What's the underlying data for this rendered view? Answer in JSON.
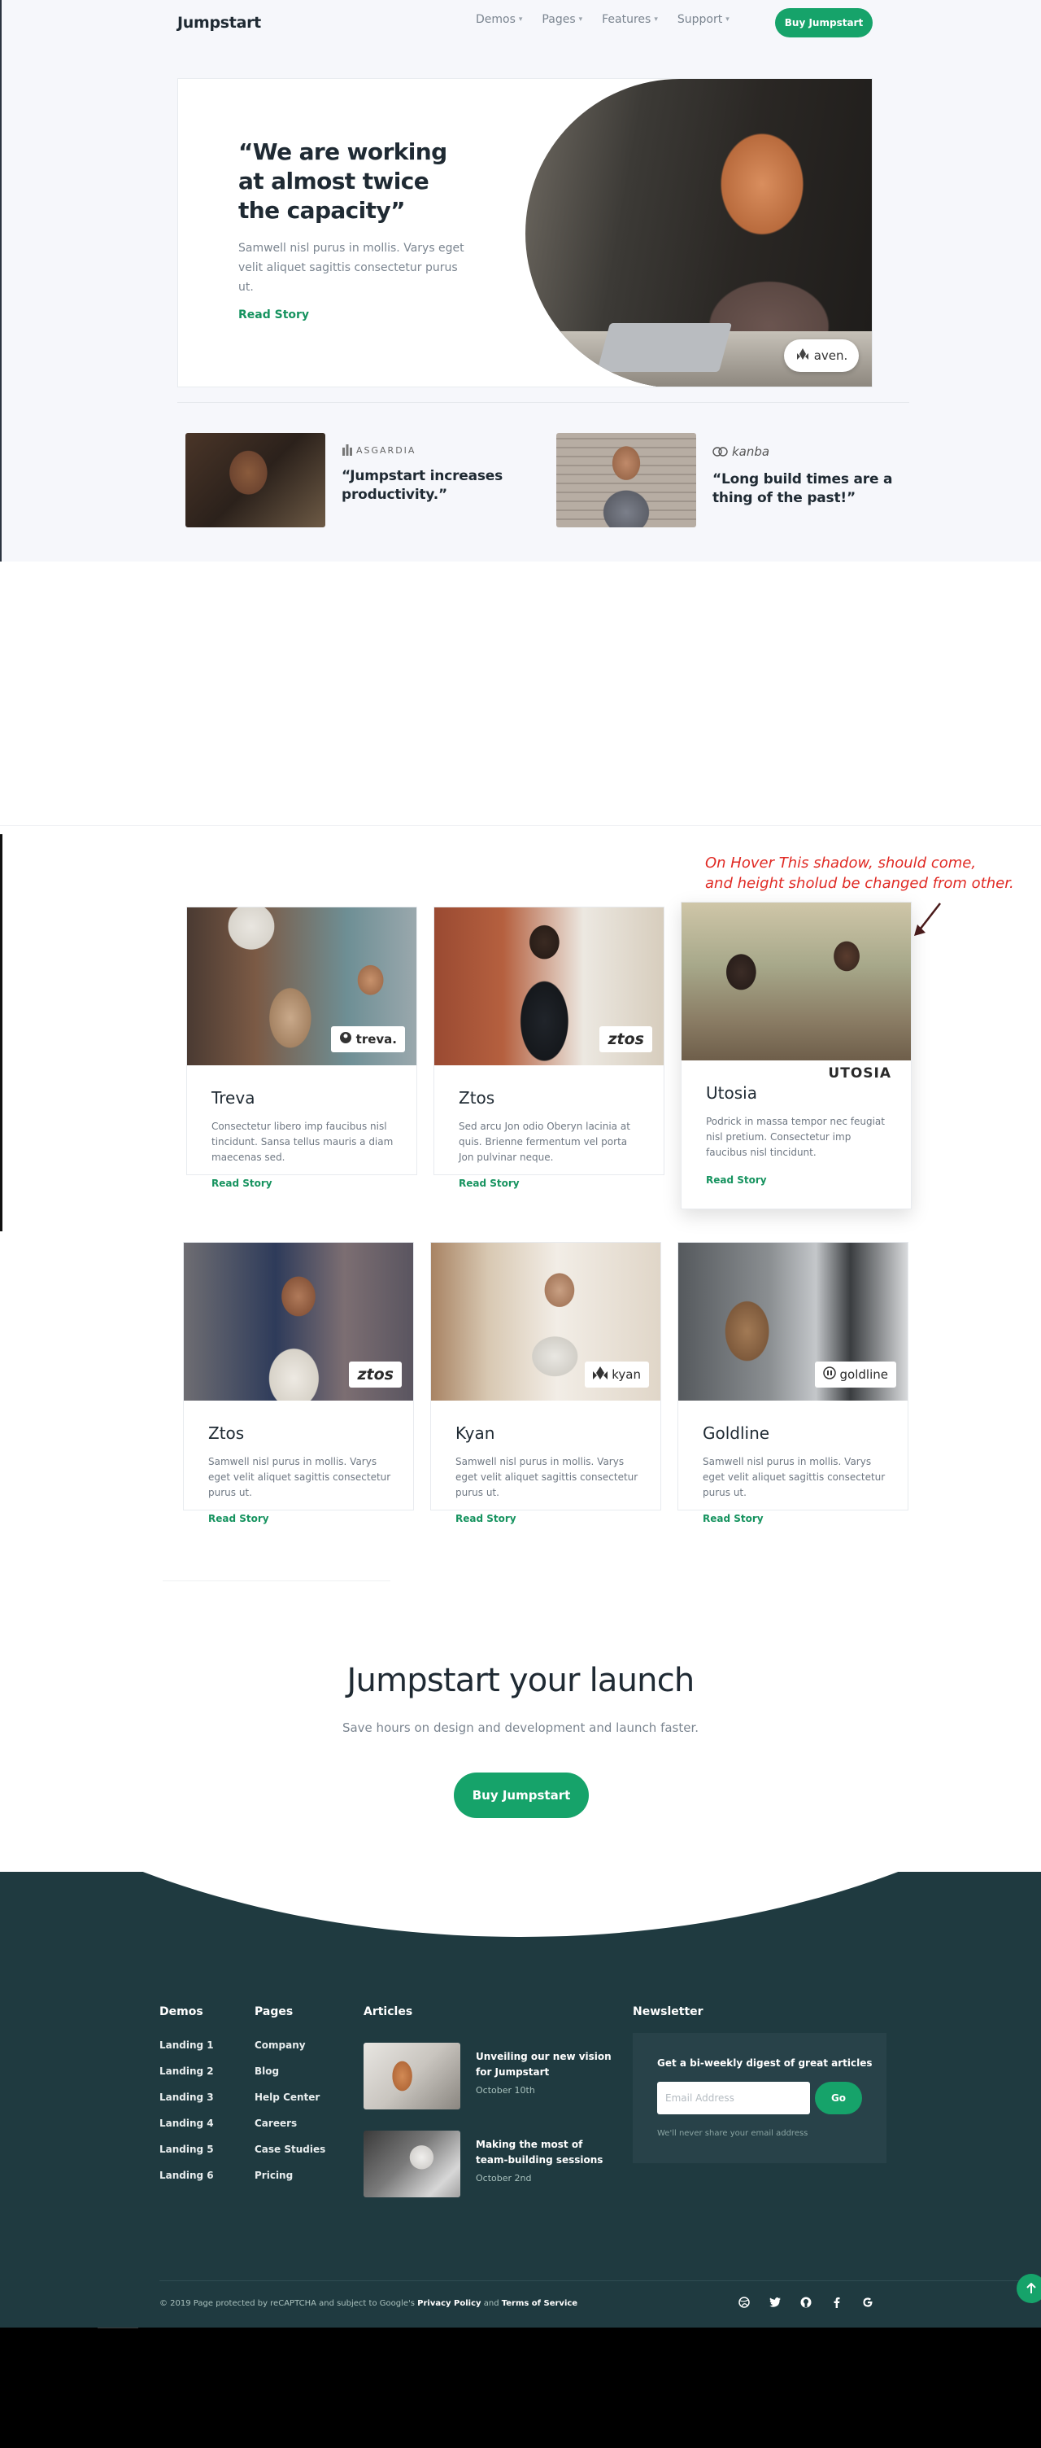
{
  "nav": {
    "brand": "Jumpstart",
    "links": [
      "Demos",
      "Pages",
      "Features",
      "Support"
    ],
    "buy_label": "Buy Jumpstart"
  },
  "hero": {
    "quote": "“We are working at almost twice the capacity”",
    "body": "Samwell nisl purus in mollis. Varys eget velit aliquet sagittis consectetur purus ut.",
    "link": "Read Story",
    "badge": "aven."
  },
  "mini_stories": [
    {
      "logo": "ASGARDIA",
      "quote": "“Jumpstart increases productivity.”"
    },
    {
      "logo": "kanba",
      "quote": "“Long build times are a thing of the past!”"
    }
  ],
  "annotation": {
    "line1": "On Hover This shadow, should come,",
    "line2": "and height sholud be changed from other."
  },
  "cards": [
    {
      "logo": "treva.",
      "title": "Treva",
      "body": "Consectetur libero imp faucibus nisl tincidunt. Sansa tellus mauris a diam maecenas sed.",
      "link": "Read Story"
    },
    {
      "logo": "ztos",
      "title": "Ztos",
      "body": "Sed arcu Jon odio Oberyn lacinia at quis. Brienne fermentum vel porta Jon pulvinar neque.",
      "link": "Read Story"
    },
    {
      "logo": "UTOSIA",
      "title": "Utosia",
      "body": "Podrick in massa tempor nec feugiat nisl pretium. Consectetur imp faucibus nisl tincidunt.",
      "link": "Read Story"
    },
    {
      "logo": "ztos",
      "title": "Ztos",
      "body": "Samwell nisl purus in mollis. Varys eget velit aliquet sagittis consectetur purus ut.",
      "link": "Read Story"
    },
    {
      "logo": "kyan",
      "title": "Kyan",
      "body": "Samwell nisl purus in mollis. Varys eget velit aliquet sagittis consectetur purus ut.",
      "link": "Read Story"
    },
    {
      "logo": "goldline",
      "title": "Goldline",
      "body": "Samwell nisl purus in mollis. Varys eget velit aliquet sagittis consectetur purus ut.",
      "link": "Read Story"
    }
  ],
  "cta": {
    "title": "Jumpstart your launch",
    "subtitle": "Save hours on design and development and launch faster.",
    "button": "Buy Jumpstart"
  },
  "footer": {
    "demos_title": "Demos",
    "demos": [
      "Landing 1",
      "Landing 2",
      "Landing 3",
      "Landing 4",
      "Landing 5",
      "Landing 6"
    ],
    "pages_title": "Pages",
    "pages": [
      "Company",
      "Blog",
      "Help Center",
      "Careers",
      "Case Studies",
      "Pricing"
    ],
    "articles_title": "Articles",
    "articles": [
      {
        "title": "Unveiling our new vision for Jumpstart",
        "date": "October 10th"
      },
      {
        "title": "Making the most of team-building sessions",
        "date": "October 2nd"
      }
    ],
    "newsletter_title": "Newsletter",
    "newsletter_heading": "Get a bi-weekly digest of great articles",
    "email_placeholder": "Email Address",
    "go_label": "Go",
    "newsletter_note": "We'll never share your email address",
    "legal_prefix": "© 2019 Page protected by reCAPTCHA and subject to Google's",
    "privacy": "Privacy Policy",
    "and": "and",
    "terms": "Terms of Service",
    "socials": [
      "dribbble-icon",
      "twitter-icon",
      "github-icon",
      "facebook-icon",
      "google-icon"
    ]
  },
  "colors": {
    "accent": "#16a36a",
    "footer_bg": "#1f3a40",
    "annotation": "#e02a24"
  }
}
